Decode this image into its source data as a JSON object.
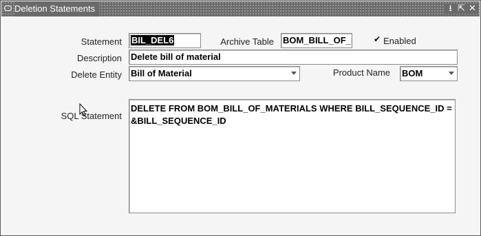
{
  "window": {
    "title": "Deletion Statements",
    "icons": [
      "window-icon",
      "minimize-icon",
      "maximize-icon",
      "close-icon"
    ],
    "minimize_glyph": "⭳",
    "maximize_glyph": "⇱",
    "close_glyph": "✕"
  },
  "form": {
    "statement_label": "Statement",
    "statement_value": "BIL_DEL6",
    "archive_label": "Archive Table",
    "archive_value": "BOM_BILL_OF_I",
    "enabled_label": "Enabled",
    "enabled_checked": true,
    "description_label": "Description",
    "description_value": "Delete bill of material",
    "delete_entity_label": "Delete Entity",
    "delete_entity_value": "Bill of Material",
    "product_label": "Product Name",
    "product_value": "BOM",
    "sql_label": "SQL Statement",
    "sql_value": "DELETE FROM BOM_BILL_OF_MATERIALS WHERE  BILL_SEQUENCE_ID = &BILL_SEQUENCE_ID"
  },
  "colors": {
    "titlebar": "#6a6a6a",
    "window_bg": "#f5f5f5",
    "selection": "#000000"
  }
}
